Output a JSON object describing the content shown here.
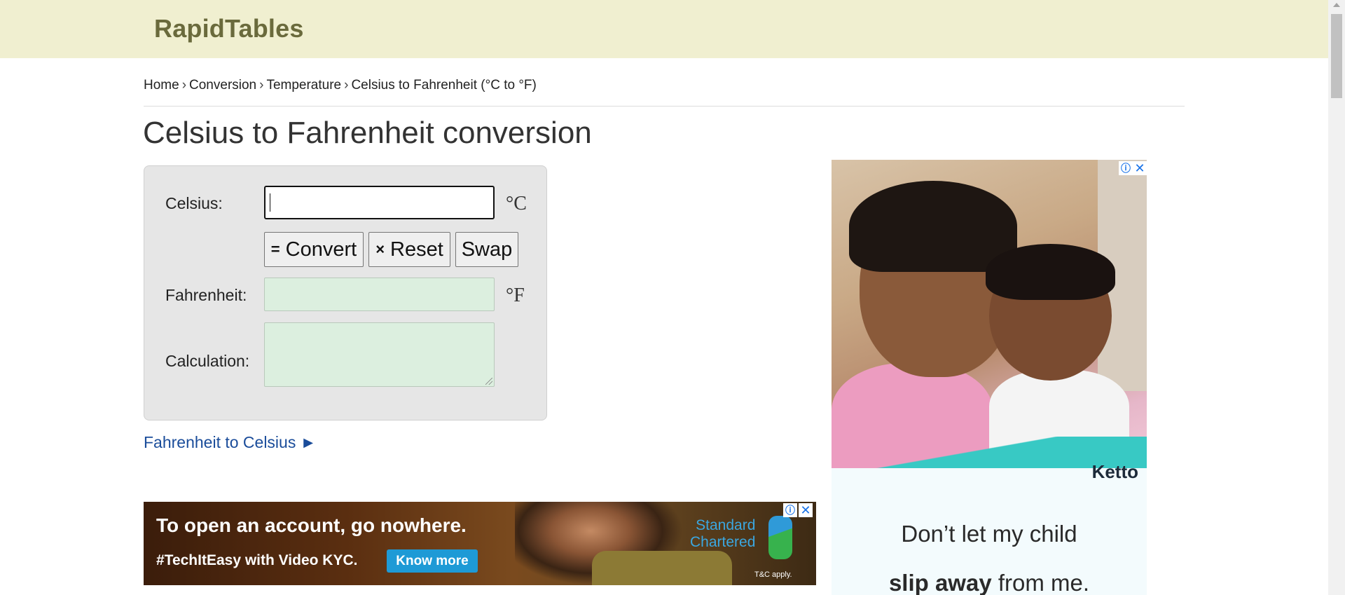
{
  "header": {
    "logo": "RapidTables"
  },
  "breadcrumb": {
    "items": [
      "Home",
      "Conversion",
      "Temperature",
      "Celsius to Fahrenheit (°C to °F)"
    ],
    "separator": "›"
  },
  "page": {
    "title": "Celsius to Fahrenheit conversion"
  },
  "calculator": {
    "celsius_label": "Celsius:",
    "celsius_value": "",
    "celsius_unit": "°C",
    "convert_icon": "=",
    "convert_label": "Convert",
    "reset_icon": "×",
    "reset_label": "Reset",
    "swap_label": "Swap",
    "fahrenheit_label": "Fahrenheit:",
    "fahrenheit_unit": "°F",
    "fahrenheit_value": "",
    "calculation_label": "Calculation:",
    "calculation_value": ""
  },
  "links": {
    "reverse": "Fahrenheit to Celsius ►"
  },
  "ads": {
    "right": {
      "brand": "Ketto",
      "line1": "Don’t let my child",
      "line2_bold": "slip away",
      "line2_rest": " from me."
    },
    "bottom": {
      "headline": "To open an account, go nowhere.",
      "subline": "#TechItEasy with Video KYC.",
      "cta": "Know more",
      "brand_line1": "Standard",
      "brand_line2": "Chartered",
      "terms": "T&C apply."
    }
  },
  "colors": {
    "header_bg": "#f0efd0",
    "logo": "#6a6a3c",
    "link": "#1a4c9a",
    "output_bg": "#dcefdf"
  }
}
